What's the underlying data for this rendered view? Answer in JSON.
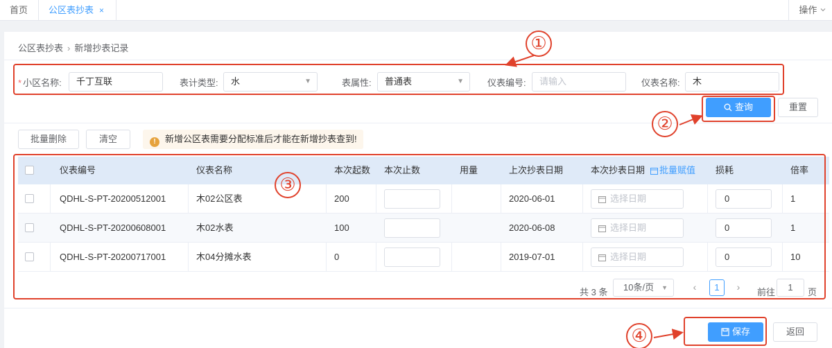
{
  "tabs": {
    "home": "首页",
    "active": "公区表抄表",
    "close": "×",
    "ops": "操作"
  },
  "breadcrumb": {
    "parent": "公区表抄表",
    "current": "新增抄表记录"
  },
  "form": {
    "community": {
      "label": "小区名称:",
      "value": "千丁互联"
    },
    "meter_type": {
      "label": "表计类型:",
      "value": "水"
    },
    "meter_attr": {
      "label": "表属性:",
      "value": "普通表"
    },
    "meter_no": {
      "label": "仪表编号:",
      "placeholder": "请输入"
    },
    "meter_name": {
      "label": "仪表名称:",
      "value": "木"
    }
  },
  "buttons": {
    "query": "查询",
    "reset": "重置",
    "batch_delete": "批量删除",
    "clear": "清空",
    "save": "保存",
    "back": "返回"
  },
  "notice": "新增公区表需要分配标准后才能在新增抄表查到!",
  "table": {
    "headers": {
      "meter_no": "仪表编号",
      "meter_name": "仪表名称",
      "start": "本次起数",
      "stop": "本次止数",
      "usage": "用量",
      "last_date": "上次抄表日期",
      "this_date": "本次抄表日期",
      "batch": "批量赋值",
      "loss": "损耗",
      "rate": "倍率"
    },
    "date_placeholder": "选择日期",
    "rows": [
      {
        "meter_no": "QDHL-S-PT-20200512001",
        "meter_name": "木02公区表",
        "start": "200",
        "stop": "",
        "usage": "",
        "last_date": "2020-06-01",
        "loss": "0",
        "rate": "1"
      },
      {
        "meter_no": "QDHL-S-PT-20200608001",
        "meter_name": "木02水表",
        "start": "100",
        "stop": "",
        "usage": "",
        "last_date": "2020-06-08",
        "loss": "0",
        "rate": "1"
      },
      {
        "meter_no": "QDHL-S-PT-20200717001",
        "meter_name": "木04分摊水表",
        "start": "0",
        "stop": "",
        "usage": "",
        "last_date": "2019-07-01",
        "loss": "0",
        "rate": "10"
      }
    ]
  },
  "pagination": {
    "total": "共 3 条",
    "page_size": "10条/页",
    "current": "1",
    "goto_label": "前往",
    "goto_value": "1",
    "page_unit": "页"
  },
  "annotations": {
    "one": "①",
    "two": "②",
    "three": "③",
    "four": "④"
  },
  "colors": {
    "accent": "#409eff",
    "annotation": "#e0412b",
    "header_bg": "#dfeaf8"
  }
}
